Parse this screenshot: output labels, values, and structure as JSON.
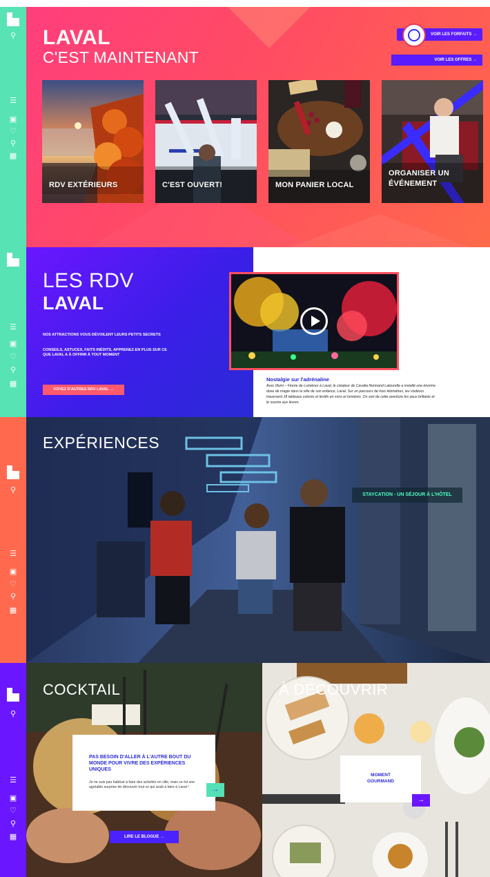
{
  "colors": {
    "rail_s1": "#57e3b3",
    "rail_s2": "#57e3b3",
    "rail_s3": "#ff6a4f",
    "rail_s4": "#6a16ff",
    "accent_purple": "#5a1bff",
    "accent_coral": "#ff5a6e",
    "accent_mint": "#55e0b8"
  },
  "rail_icons": [
    "logo-icon",
    "search-icon",
    "menu-icon",
    "car-icon",
    "heart-icon",
    "location-pin-icon",
    "calendar-icon"
  ],
  "hero": {
    "title_line1": "LAVAL",
    "title_line2": "C'EST MAINTENANT",
    "btn_forfaits": "VOIR LES FORFAITS →",
    "btn_offres": "VOIR LES OFFRES →",
    "cards": [
      {
        "label": "RDV EXTÉRIEURS"
      },
      {
        "label": "C'EST OUVERT!"
      },
      {
        "label": "MON PANIER LOCAL"
      },
      {
        "label_line1": "ORGANISER UN",
        "label_line2": "ÉVÉNEMENT"
      }
    ]
  },
  "rdv": {
    "title_line1": "LES RDV",
    "title_line2": "LAVAL",
    "intro1": "NOS ATTRACTIONS VOUS DÉVOILENT LEURS PETITS SECRETS",
    "intro2": "CONSEILS, ASTUCES, FAITS INÉDITS, APPRENEZ-EN PLUS SUR CE QUE LAVAL A À OFFRIR À TOUT MOMENT",
    "btn_voyez": "VOYEZ D'AUTRES RDV LAVAL →",
    "article_title": "Nostalgie sur l'adrénaline",
    "article_body": "Avec Illumi – Féerie de Lumières à Laval, le créateur de Cavalia Normand Latourelle a installé une énorme dose de magie dans la ville de son enfance, Laval. Sur un parcours de trois kilomètres, les visiteurs traversent 18 tableaux colorés et festifs en sons et lumières. On sort de cette aventure les yeux brillants et le sourire aux lèvres."
  },
  "experiences": {
    "title": "EXPÉRIENCES",
    "badge": "STAYCATION - UN SÉJOUR À L'HÔTEL"
  },
  "cocktail": {
    "title": "COCKTAIL",
    "card_heading": "PAS BESOIN D'ALLER À L'AUTRE BOUT DU MONDE POUR VIVRE DES EXPÉRIENCES UNIQUES",
    "card_body": "Je ne suis pas habitué à faire des activités en ville, mais ce fut une agréable surprise de découvrir tout ce qui avait à faire à Laval !",
    "arrow": "→",
    "btn_blogue": "LIRE LE BLOGUE →"
  },
  "decouvrir": {
    "title": "À DÉCOUVRIR",
    "card_text_line1": "MOMENT",
    "card_text_line2": "GOURMAND",
    "arrow": "→"
  }
}
